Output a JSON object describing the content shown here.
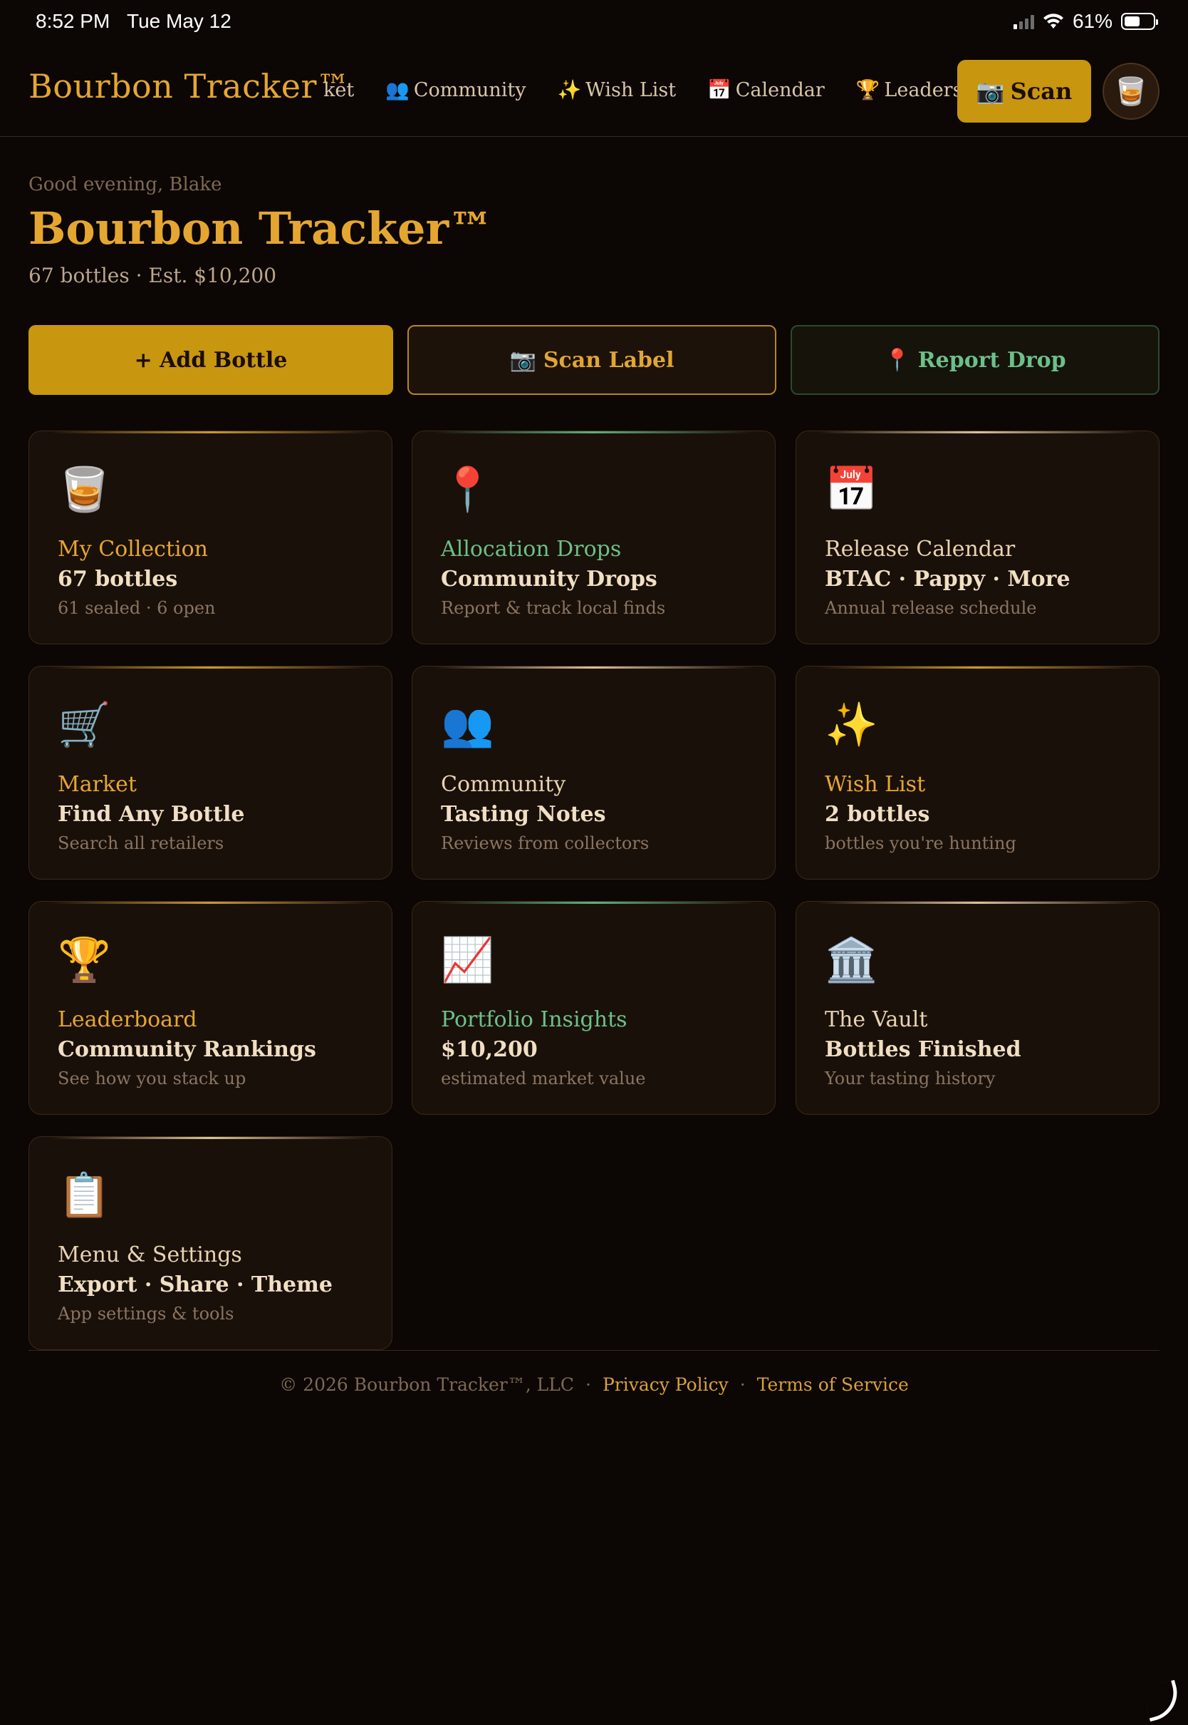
{
  "status_bar": {
    "time": "8:52 PM",
    "date": "Tue May 12",
    "battery": "61%"
  },
  "nav": {
    "brand": "Bourbon Tracker™",
    "links": [
      {
        "icon": "",
        "label": "ket"
      },
      {
        "icon": "👥",
        "label": "Community"
      },
      {
        "icon": "✨",
        "label": "Wish List"
      },
      {
        "icon": "📅",
        "label": "Calendar"
      },
      {
        "icon": "🏆",
        "label": "Leaders"
      }
    ],
    "scan_icon": "📷",
    "scan_label": "Scan",
    "avatar_icon": "🥃"
  },
  "header": {
    "greeting": "Good evening, Blake",
    "title": "Bourbon Tracker™",
    "subtitle": "67 bottles · Est. $10,200"
  },
  "actions": {
    "add_label": "+ Add Bottle",
    "scan_icon": "📷",
    "scan_label": "Scan Label",
    "report_icon": "📍",
    "report_label": "Report Drop"
  },
  "cards": [
    {
      "icon": "🥃",
      "label": "My Collection",
      "value": "67 bottles",
      "desc": "61 sealed · 6 open"
    },
    {
      "icon": "📍",
      "label": "Allocation Drops",
      "value": "Community Drops",
      "desc": "Report & track local finds"
    },
    {
      "icon": "📅",
      "label": "Release Calendar",
      "value": "BTAC · Pappy · More",
      "desc": "Annual release schedule"
    },
    {
      "icon": "🛒",
      "label": "Market",
      "value": "Find Any Bottle",
      "desc": "Search all retailers"
    },
    {
      "icon": "👥",
      "label": "Community",
      "value": "Tasting Notes",
      "desc": "Reviews from collectors"
    },
    {
      "icon": "✨",
      "label": "Wish List",
      "value": "2 bottles",
      "desc": "bottles you're hunting"
    },
    {
      "icon": "🏆",
      "label": "Leaderboard",
      "value": "Community Rankings",
      "desc": "See how you stack up"
    },
    {
      "icon": "📈",
      "label": "Portfolio Insights",
      "value": "$10,200",
      "desc": "estimated market value"
    },
    {
      "icon": "🏛️",
      "label": "The Vault",
      "value": "Bottles Finished",
      "desc": "Your tasting history"
    },
    {
      "icon": "📋",
      "label": "Menu & Settings",
      "value": "Export · Share · Theme",
      "desc": "App settings & tools"
    }
  ],
  "footer": {
    "copyright": "© 2026 Bourbon Tracker™, LLC",
    "sep1": "·",
    "privacy": "Privacy Policy",
    "sep2": "·",
    "terms": "Terms of Service"
  },
  "colors": {
    "background": "#0c0604",
    "accent_gold": "#e5a631",
    "button_gold": "#c8960f",
    "accent_green": "#6cc088",
    "card_bg": "#1a100a"
  }
}
